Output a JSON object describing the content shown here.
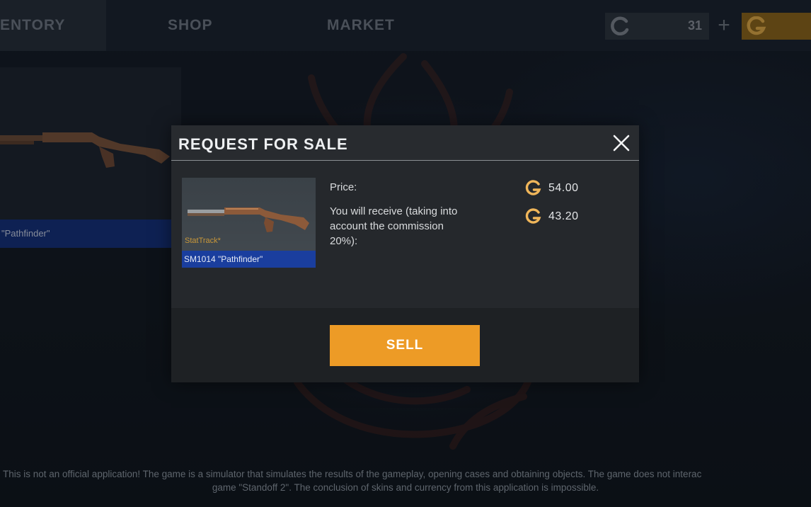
{
  "nav": {
    "tabs": [
      {
        "label": "ENTORY",
        "active": true
      },
      {
        "label": "SHOP",
        "active": false
      },
      {
        "label": "MARKET",
        "active": false
      }
    ]
  },
  "wallet": {
    "silver_value": "31",
    "plus_label": "+",
    "silver_color": "#8a9098",
    "gold_color": "#c98c1f"
  },
  "inventory_card": {
    "name": "\"Pathfinder\""
  },
  "dialog": {
    "title": "REQUEST FOR SALE",
    "item": {
      "stattrack_label": "StatTrack*",
      "name": "SM1014 \"Pathfinder\""
    },
    "price_label": "Price:",
    "receive_label": "You will receive (taking into account the commission 20%):",
    "price_value": "54.00",
    "receive_value": "43.20",
    "sell_label": "SELL",
    "accent_color": "#ed9b26"
  },
  "disclaimer": {
    "line1": "This is not an official application! The game is a simulator that simulates the results of the gameplay, opening cases and obtaining objects. The game does not interac",
    "line2": "game \"Standoff 2\". The conclusion of skins and currency from this application is impossible."
  }
}
